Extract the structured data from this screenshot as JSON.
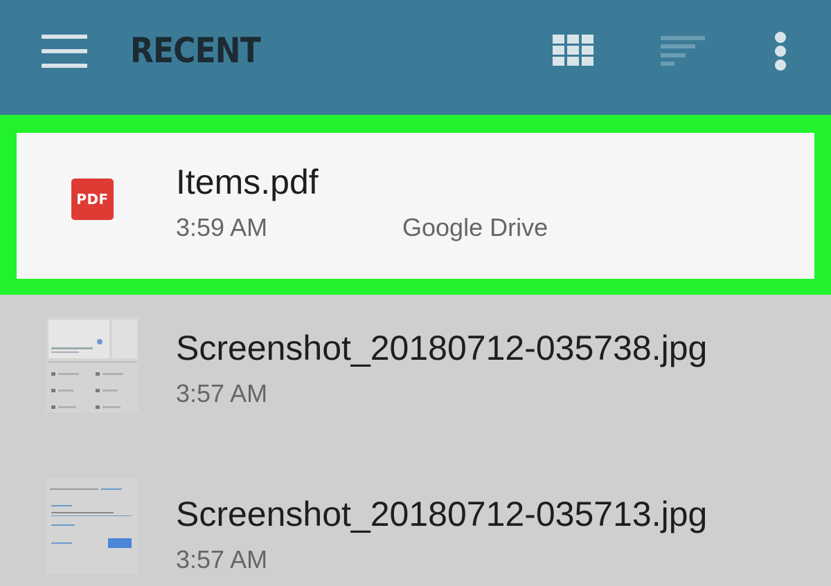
{
  "appbar": {
    "title": "RECENT",
    "menu_icon": "hamburger-menu-icon",
    "grid_icon": "grid-view-icon",
    "sort_icon": "sort-icon",
    "more_icon": "more-vert-icon"
  },
  "files": [
    {
      "name": "Items.pdf",
      "time": "3:59 AM",
      "location": "Google Drive",
      "icon": "pdf-icon",
      "icon_label": "PDF",
      "selected": true
    },
    {
      "name": "Screenshot_20180712-035738.jpg",
      "time": "3:57 AM",
      "icon": "image-thumbnail"
    },
    {
      "name": "Screenshot_20180712-035713.jpg",
      "time": "3:57 AM",
      "icon": "image-thumbnail"
    }
  ],
  "colors": {
    "appbar": "#3b7b97",
    "highlight": "#22f22c",
    "pdf_red": "#de3b34",
    "list_background": "#cfcfcf"
  }
}
